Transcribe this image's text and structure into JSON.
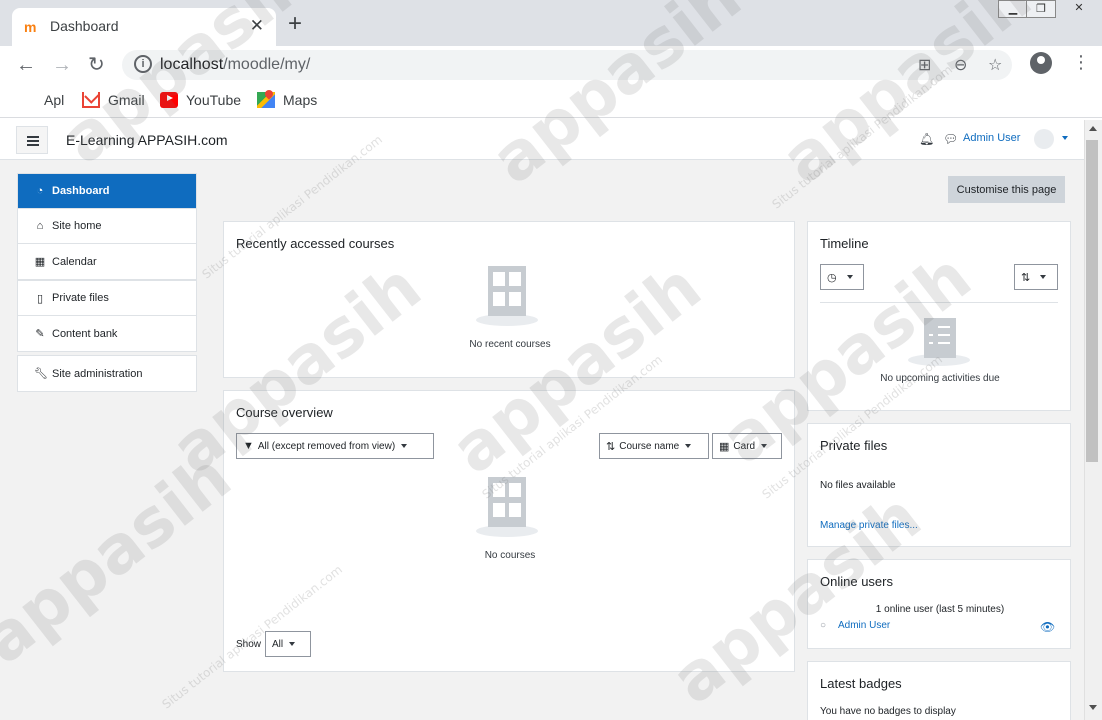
{
  "browser": {
    "tab_title": "Dashboard",
    "favicon_text": "m",
    "url_host": "localhost",
    "url_path": "/moodle/my/",
    "bookmarks": [
      {
        "label": "Apl",
        "icon": "apps-grid-icon"
      },
      {
        "label": "Gmail",
        "icon": "gmail-icon"
      },
      {
        "label": "YouTube",
        "icon": "youtube-icon"
      },
      {
        "label": "Maps",
        "icon": "maps-icon"
      }
    ]
  },
  "navbar": {
    "site_name": "E-Learning APPASIH.com",
    "user_name": "Admin User"
  },
  "sidebar": {
    "items": [
      {
        "label": "Dashboard",
        "icon": "dashboard-icon",
        "active": true
      },
      {
        "label": "Site home",
        "icon": "home-icon"
      },
      {
        "label": "Calendar",
        "icon": "calendar-icon"
      },
      {
        "label": "Private files",
        "icon": "file-icon"
      },
      {
        "label": "Content bank",
        "icon": "paint-brush-icon"
      },
      {
        "label": "Site administration",
        "icon": "wrench-icon"
      }
    ]
  },
  "header": {
    "customise_label": "Customise this page"
  },
  "recent": {
    "title": "Recently accessed courses",
    "empty": "No recent courses"
  },
  "overview": {
    "title": "Course overview",
    "filter_label": "All (except removed from view)",
    "sort_label": "Course name",
    "view_label": "Card",
    "empty": "No courses",
    "show_label": "Show",
    "show_value": "All"
  },
  "timeline": {
    "title": "Timeline",
    "empty": "No upcoming activities due"
  },
  "private_files": {
    "title": "Private files",
    "empty": "No files available",
    "manage_link": "Manage private files..."
  },
  "online_users": {
    "title": "Online users",
    "summary": "1 online user (last 5 minutes)",
    "users": [
      "Admin User"
    ]
  },
  "badges": {
    "title": "Latest badges",
    "empty": "You have no badges to display"
  },
  "watermark": {
    "brand": "appasih",
    "tagline": "Situs tutorial aplikasi Pendidikan.com"
  },
  "colors": {
    "primary": "#0f6cbf",
    "page_bg": "#f2f2f2"
  }
}
